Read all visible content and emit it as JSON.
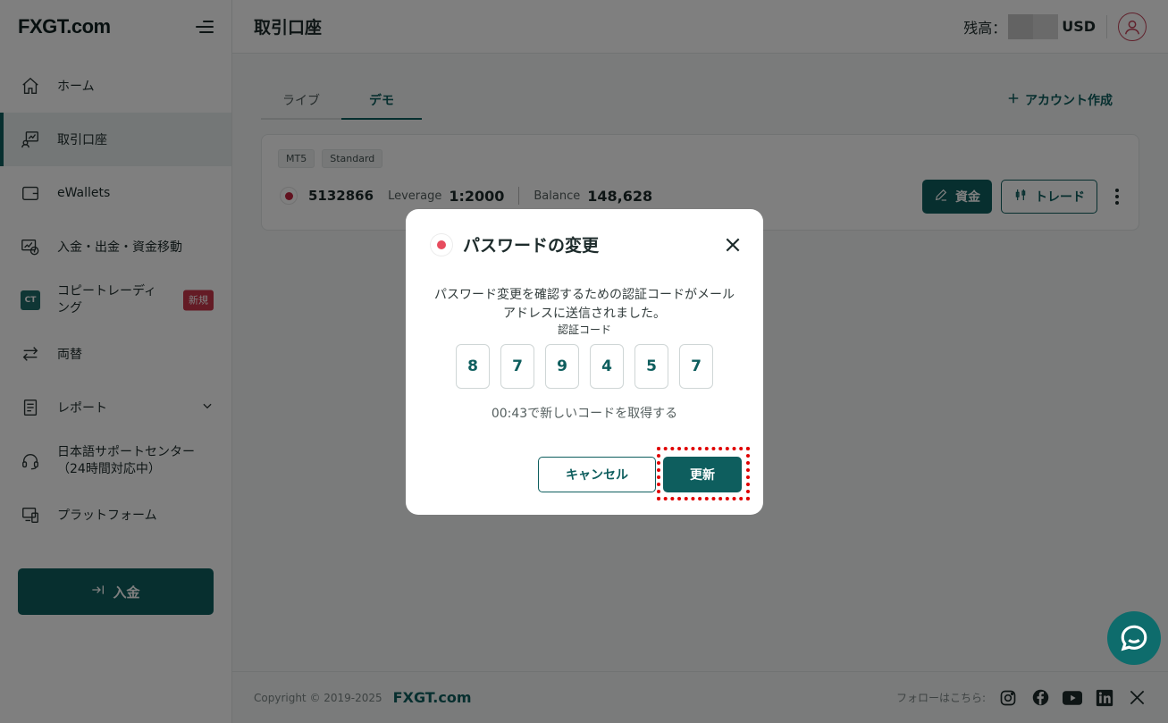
{
  "brand": {
    "logo": "FXGT.com"
  },
  "sidebar": {
    "items": [
      {
        "label": "ホーム"
      },
      {
        "label": "取引口座"
      },
      {
        "label": "eWallets"
      },
      {
        "label": "入金・出金・資金移動"
      },
      {
        "label": "コピートレーディング",
        "line1": "コピートレーディ",
        "line2": "ング",
        "badge": "新規"
      },
      {
        "label": "両替"
      },
      {
        "label": "レポート"
      },
      {
        "label": "日本語サポートセンター（24時間対応中）",
        "line1": "日本語サポートセンター",
        "line2": "（24時間対応中）"
      },
      {
        "label": "プラットフォーム"
      }
    ],
    "deposit_label": "入金"
  },
  "header": {
    "title": "取引口座",
    "balance_label": "残高：",
    "currency": "USD"
  },
  "main": {
    "tabs": [
      {
        "label": "ライブ"
      },
      {
        "label": "デモ"
      }
    ],
    "add_account": "アカウント作成",
    "account": {
      "chips": [
        "MT5",
        "Standard"
      ],
      "number": "5132866",
      "leverage_label": "Leverage",
      "leverage": "1:2000",
      "balance_label": "Balance",
      "balance": "148,628",
      "fund_label": "資金",
      "trade_label": "トレード"
    }
  },
  "footer": {
    "copyright": "Copyright © 2019-2025",
    "brand": "FXGT.com",
    "follow": "フォローはこちら:",
    "social_icons": [
      "instagram-icon",
      "facebook-icon",
      "youtube-icon",
      "linkedin-icon",
      "x-icon"
    ]
  },
  "modal": {
    "title": "パスワードの変更",
    "desc_line1": "パスワード変更を確認するための認証コードがメール",
    "desc_line2": "アドレスに送信されました。",
    "code_label": "認証コード",
    "code": [
      "8",
      "7",
      "9",
      "4",
      "5",
      "7"
    ],
    "resend": "00:43で新しいコードを取得する",
    "cancel": "キャンセル",
    "update": "更新"
  },
  "colors": {
    "primary": "#0e5e5e",
    "accent_red": "#e74c5e",
    "highlight": "#e00000"
  }
}
